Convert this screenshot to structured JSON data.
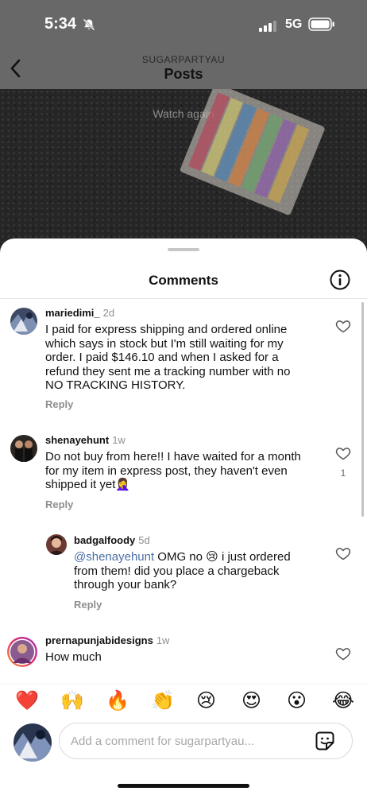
{
  "status_bar": {
    "time": "5:34",
    "network": "5G"
  },
  "nav": {
    "subtitle": "SUGARPARTYAU",
    "title": "Posts"
  },
  "video": {
    "overlay_text": "Watch again"
  },
  "sheet": {
    "title": "Comments"
  },
  "comments": [
    {
      "username": "mariedimi_",
      "time": "2d",
      "text": "I paid for express shipping and ordered online which says in stock but I'm still waiting for my order. I paid $146.10 and when I asked for a refund they sent me a tracking number with no NO TRACKING HISTORY.",
      "reply_label": "Reply"
    },
    {
      "username": "shenayehunt",
      "time": "1w",
      "text": "Do not buy from here!! I have waited for a month for my item in express post, they haven't even shipped it yet🤦‍♀️",
      "like_count": "1",
      "reply_label": "Reply"
    },
    {
      "username": "badgalfoody",
      "time": "5d",
      "mention": "@shenayehunt",
      "text": " OMG no 😢 i just ordered from them! did you place a chargeback through your bank?",
      "reply_label": "Reply"
    },
    {
      "username": "prernapunjabidesigns",
      "time": "1w",
      "text": "How much"
    }
  ],
  "emoji_bar": [
    "❤️",
    "🙌",
    "🔥",
    "👏",
    "😢",
    "😍",
    "😮",
    "😂"
  ],
  "composer": {
    "placeholder": "Add a comment for sugarpartyau..."
  },
  "colors": {
    "mention": "#4a6fa5",
    "heart_emoji": "#e0245e",
    "dim_overlay": "#686868"
  },
  "icons": [
    "bell-slash-icon",
    "signal-icon",
    "battery-icon",
    "back-chevron-icon",
    "info-icon",
    "heart-icon",
    "sticker-icon"
  ]
}
